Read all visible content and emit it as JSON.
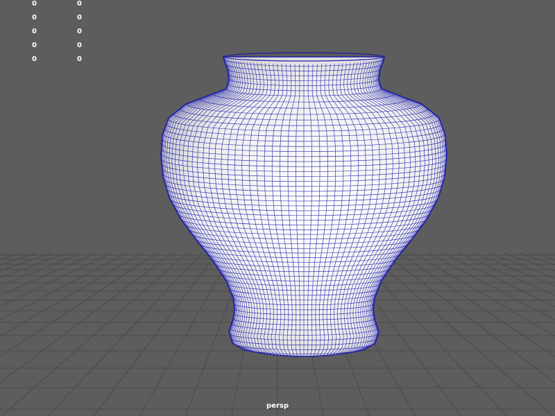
{
  "viewport": {
    "camera_name": "persp",
    "background_color": "#5d5d5d",
    "grid_color": "#4a4a4a",
    "wire_color": "#1c1ca8",
    "mesh_fill_color": "#f2f2f2"
  },
  "hud": {
    "rows": [
      {
        "col1": "0",
        "col2": "0"
      },
      {
        "col1": "0",
        "col2": "0"
      },
      {
        "col1": "0",
        "col2": "0"
      },
      {
        "col1": "0",
        "col2": "0"
      },
      {
        "col1": "0",
        "col2": "0"
      }
    ]
  },
  "object": {
    "icon": "vase-wireframe-mesh"
  }
}
